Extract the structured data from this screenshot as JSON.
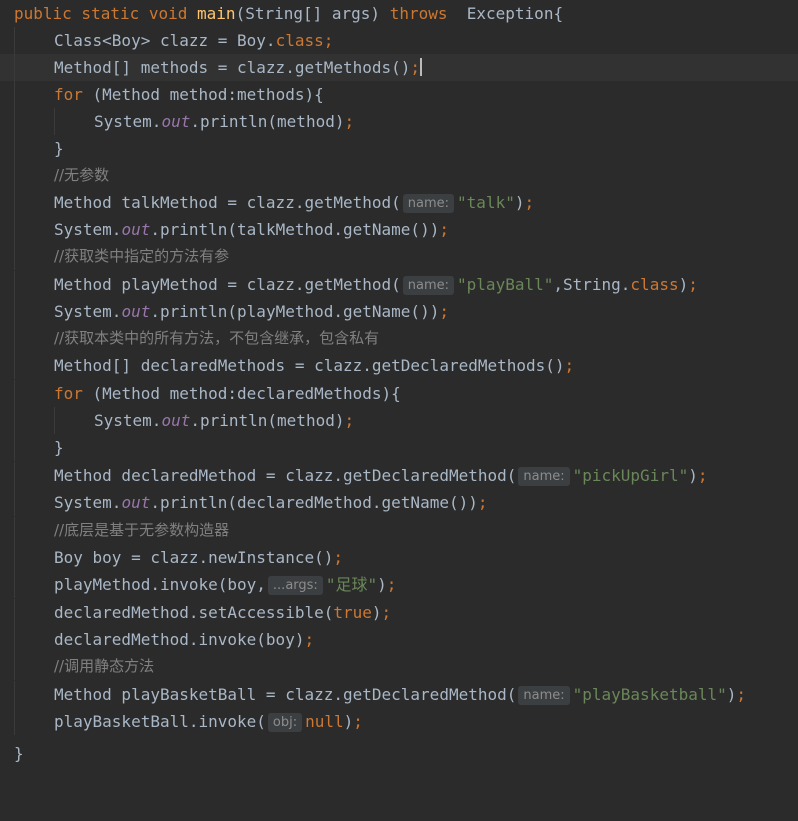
{
  "code": {
    "l1": {
      "kw1": "public static void ",
      "fn": "main",
      "p1": "(String[] args) ",
      "kw2": "throws",
      "p2": "  Exception{"
    },
    "l2": {
      "p1": "Class<Boy> clazz = Boy.",
      "kw": "class",
      "semi": ";"
    },
    "l3": {
      "p1": "Method[] methods = clazz.getMethods()",
      "semi": ";"
    },
    "l4": {
      "kw": "for",
      "p1": " (Method method:methods){"
    },
    "l5": {
      "p1": "System.",
      "field": "out",
      "p2": ".println(method)",
      "semi": ";"
    },
    "l6": {
      "p1": "}"
    },
    "l7": {
      "cm": "//无参数"
    },
    "l8": {
      "p1": "Method talkMethod = clazz.getMethod(",
      "hint": "name:",
      "str": "\"talk\"",
      "p2": ")",
      "semi": ";"
    },
    "l9": {
      "p1": "System.",
      "field": "out",
      "p2": ".println(talkMethod.getName())",
      "semi": ";"
    },
    "l10": {
      "cm": "//获取类中指定的方法有参"
    },
    "l11": {
      "p1": "Method playMethod = clazz.getMethod(",
      "hint": "name:",
      "str": "\"playBall\"",
      "p2": ",String.",
      "kw": "class",
      "p3": ")",
      "semi": ";"
    },
    "l12": {
      "p1": "System.",
      "field": "out",
      "p2": ".println(playMethod.getName())",
      "semi": ";"
    },
    "l13": {
      "cm": "//获取本类中的所有方法，不包含继承，包含私有"
    },
    "l14": {
      "p1": "Method[] declaredMethods = clazz.getDeclaredMethods()",
      "semi": ";"
    },
    "l15": {
      "kw": "for",
      "p1": " (Method method:declaredMethods){"
    },
    "l16": {
      "p1": "System.",
      "field": "out",
      "p2": ".println(method)",
      "semi": ";"
    },
    "l17": {
      "p1": "}"
    },
    "l18": {
      "p1": "Method declaredMethod = clazz.getDeclaredMethod(",
      "hint": "name:",
      "str": "\"pickUpGirl\"",
      "p2": ")",
      "semi": ";"
    },
    "l19": {
      "p1": "System.",
      "field": "out",
      "p2": ".println(declaredMethod.getName())",
      "semi": ";"
    },
    "l20": {
      "cm": "//底层是基于无参数构造器"
    },
    "l21": {
      "p1": "Boy boy = clazz.newInstance()",
      "semi": ";"
    },
    "l22": {
      "p1": "playMethod.invoke(boy,",
      "hint": "...args:",
      "str": "\"足球\"",
      "p2": ")",
      "semi": ";"
    },
    "l23": {
      "p1": "declaredMethod.setAccessible(",
      "kw": "true",
      "p2": ")",
      "semi": ";"
    },
    "l24": {
      "p1": "declaredMethod.invoke(boy)",
      "semi": ";"
    },
    "l25": {
      "cm": "//调用静态方法"
    },
    "l26": {
      "p1": "Method playBasketBall = clazz.getDeclaredMethod(",
      "hint": "name:",
      "str": "\"playBasketball\"",
      "p2": ")",
      "semi": ";"
    },
    "l27": {
      "p1": "playBasketBall.invoke(",
      "hint": "obj:",
      "kw": "null",
      "p2": ")",
      "semi": ";"
    },
    "l28": {
      "p1": "}"
    }
  },
  "colors": {
    "background": "#2b2b2b",
    "current_line": "#323232",
    "keyword": "#cc7832",
    "method_decl": "#ffc66d",
    "string": "#6a8759",
    "static_field": "#9876aa",
    "comment": "#808080",
    "default_text": "#a9b7c6",
    "hint_bg": "#3b3f41"
  }
}
